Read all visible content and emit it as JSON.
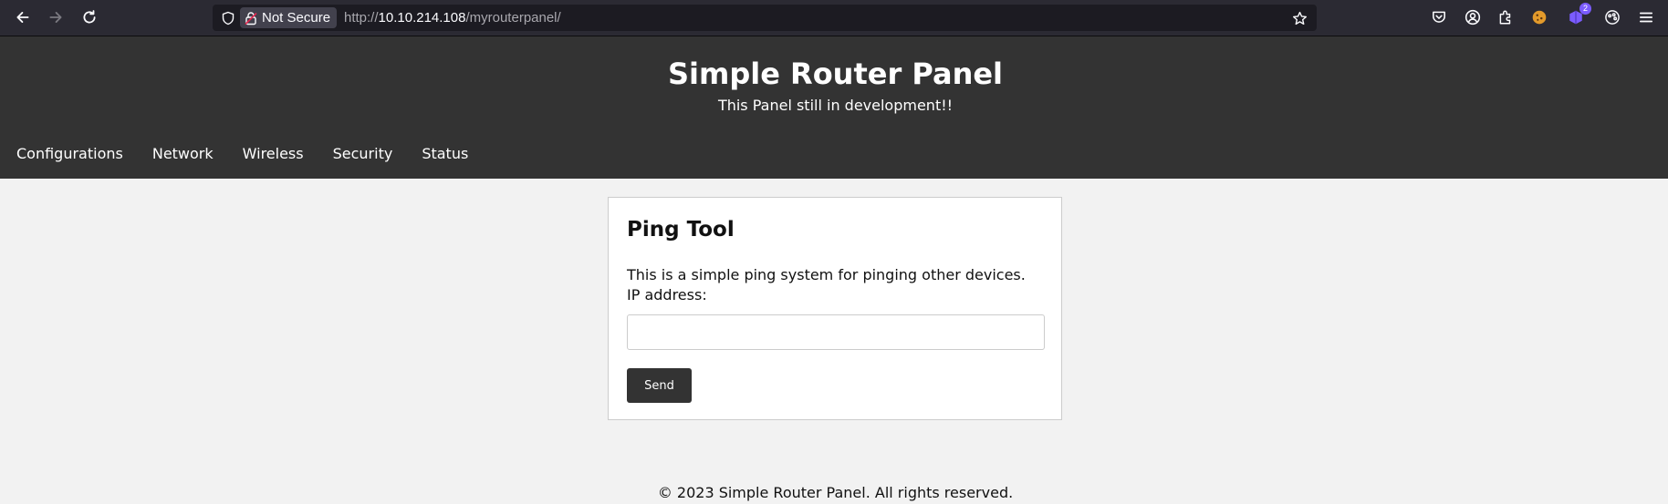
{
  "browser": {
    "security_label": "Not Secure",
    "url_scheme": "http://",
    "url_host": "10.10.214.108",
    "url_path": "/myrouterpanel/",
    "extension_badge": "2"
  },
  "site": {
    "title": "Simple Router Panel",
    "subtitle": "This Panel still in development!!",
    "nav": [
      "Configurations",
      "Network",
      "Wireless",
      "Security",
      "Status"
    ]
  },
  "ping_tool": {
    "title": "Ping Tool",
    "description": "This is a simple ping system for pinging other devices.",
    "ip_label": "IP address:",
    "ip_value": "",
    "send_label": "Send"
  },
  "footer": {
    "text": "© 2023 Simple Router Panel. All rights reserved."
  }
}
